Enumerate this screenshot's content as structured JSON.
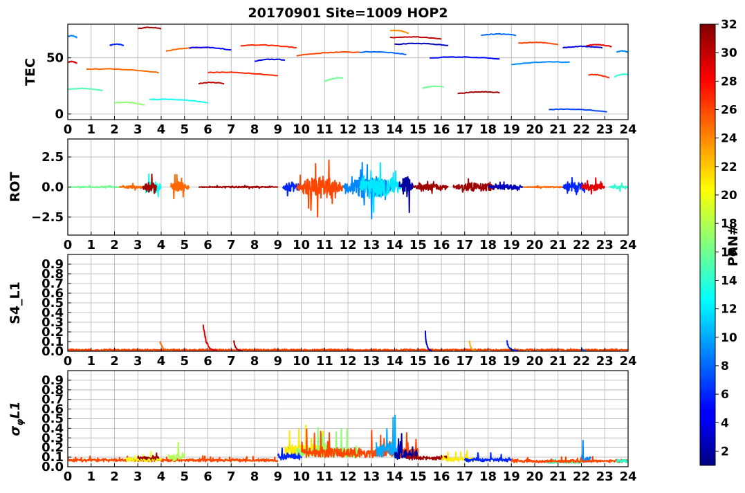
{
  "chart_data": {
    "title": "20170901 Site=1009 HOP2",
    "type": "line",
    "x_ticks": [
      "0",
      "1",
      "2",
      "3",
      "4",
      "5",
      "6",
      "7",
      "8",
      "9",
      "10",
      "11",
      "12",
      "13",
      "14",
      "15",
      "16",
      "17",
      "18",
      "19",
      "20",
      "21",
      "22",
      "23",
      "24"
    ],
    "xlim": [
      0,
      24
    ],
    "grid": true,
    "panels": [
      {
        "id": "tec",
        "ylabel": "TEC",
        "ylim": [
          -5,
          80
        ],
        "y_ticks": [
          {
            "v": 0,
            "t": "0"
          },
          {
            "v": 50,
            "t": "50"
          }
        ],
        "segments": [
          {
            "prn": 9,
            "x": [
              0,
              0.4
            ],
            "y": [
              69,
              68
            ]
          },
          {
            "prn": 29,
            "x": [
              0,
              0.4
            ],
            "y": [
              46,
              45
            ]
          },
          {
            "prn": 15,
            "x": [
              0,
              1.5
            ],
            "y": [
              22,
              21
            ]
          },
          {
            "prn": 25,
            "x": [
              0.8,
              3.9
            ],
            "y": [
              40,
              37
            ]
          },
          {
            "prn": 17,
            "x": [
              2,
              3.3
            ],
            "y": [
              10,
              8
            ]
          },
          {
            "prn": 13,
            "x": [
              3.5,
              6
            ],
            "y": [
              13,
              10
            ]
          },
          {
            "prn": 31,
            "x": [
              3,
              4
            ],
            "y": [
              76,
              76
            ]
          },
          {
            "prn": 6,
            "x": [
              1.8,
              2.4
            ],
            "y": [
              61,
              61
            ]
          },
          {
            "prn": 25,
            "x": [
              4.2,
              6
            ],
            "y": [
              56,
              59
            ]
          },
          {
            "prn": 5,
            "x": [
              5.2,
              7
            ],
            "y": [
              59,
              57
            ]
          },
          {
            "prn": 27,
            "x": [
              6,
              9
            ],
            "y": [
              37,
              34
            ]
          },
          {
            "prn": 30,
            "x": [
              5.6,
              6.7
            ],
            "y": [
              27,
              27
            ]
          },
          {
            "prn": 27,
            "x": [
              7.4,
              9.8
            ],
            "y": [
              61,
              59
            ]
          },
          {
            "prn": 4,
            "x": [
              8,
              9.3
            ],
            "y": [
              47,
              48
            ]
          },
          {
            "prn": 26,
            "x": [
              9.8,
              12.5
            ],
            "y": [
              52,
              55
            ]
          },
          {
            "prn": 8,
            "x": [
              12.5,
              14.5
            ],
            "y": [
              55,
              53
            ]
          },
          {
            "prn": 16,
            "x": [
              11,
              11.8
            ],
            "y": [
              29,
              32
            ]
          },
          {
            "prn": 24,
            "x": [
              13.8,
              14.6
            ],
            "y": [
              74,
              72
            ]
          },
          {
            "prn": 30,
            "x": [
              13.8,
              16
            ],
            "y": [
              68,
              67
            ]
          },
          {
            "prn": 3,
            "x": [
              14,
              16.3
            ],
            "y": [
              62,
              61
            ]
          },
          {
            "prn": 16,
            "x": [
              15.2,
              16.1
            ],
            "y": [
              23,
              24
            ]
          },
          {
            "prn": 5,
            "x": [
              15.5,
              18.5
            ],
            "y": [
              50,
              49
            ]
          },
          {
            "prn": 31,
            "x": [
              16.7,
              18.5
            ],
            "y": [
              18,
              19
            ]
          },
          {
            "prn": 8,
            "x": [
              17.7,
              19.2
            ],
            "y": [
              70,
              70
            ]
          },
          {
            "prn": 9,
            "x": [
              19,
              21.5
            ],
            "y": [
              44,
              46
            ]
          },
          {
            "prn": 26,
            "x": [
              19.3,
              21
            ],
            "y": [
              63,
              62
            ]
          },
          {
            "prn": 7,
            "x": [
              20.6,
              23.1
            ],
            "y": [
              4,
              2
            ]
          },
          {
            "prn": 4,
            "x": [
              21.2,
              22.9
            ],
            "y": [
              59,
              59
            ]
          },
          {
            "prn": 29,
            "x": [
              22.2,
              23.3
            ],
            "y": [
              61,
              60
            ]
          },
          {
            "prn": 27,
            "x": [
              22.3,
              23.2
            ],
            "y": [
              35,
              32
            ]
          },
          {
            "prn": 14,
            "x": [
              23.4,
              24
            ],
            "y": [
              33,
              35
            ]
          },
          {
            "prn": 9,
            "x": [
              23.5,
              24
            ],
            "y": [
              55,
              55
            ]
          }
        ]
      },
      {
        "id": "rot",
        "ylabel": "ROT",
        "ylim": [
          -4,
          4
        ],
        "y_ticks": [
          {
            "v": 2.5,
            "t": "2.5"
          },
          {
            "v": 0,
            "t": "0.0"
          },
          {
            "v": -2.5,
            "t": "−2.5"
          }
        ],
        "segments": [
          {
            "prn": 16,
            "x": [
              0,
              2.5
            ],
            "amp": 0.15
          },
          {
            "prn": 25,
            "x": [
              2.2,
              3.4
            ],
            "amp": 0.3
          },
          {
            "prn": 13,
            "x": [
              3.3,
              4
            ],
            "amp": 1.6
          },
          {
            "prn": 31,
            "x": [
              3.2,
              3.8
            ],
            "amp": 1.2
          },
          {
            "prn": 25,
            "x": [
              4.4,
              5.2
            ],
            "amp": 1.4
          },
          {
            "prn": 31,
            "x": [
              5.6,
              9
            ],
            "amp": 0.15
          },
          {
            "prn": 6,
            "x": [
              9.2,
              10
            ],
            "amp": 1.2
          },
          {
            "prn": 26,
            "x": [
              9.8,
              11.8
            ],
            "amp": 2.6
          },
          {
            "prn": 9,
            "x": [
              11.8,
              13.9
            ],
            "amp": 2.8
          },
          {
            "prn": 12,
            "x": [
              12.5,
              14.3
            ],
            "amp": 2.4
          },
          {
            "prn": 2,
            "x": [
              14.2,
              14.8
            ],
            "amp": 2.5
          },
          {
            "prn": 31,
            "x": [
              14.8,
              16.3
            ],
            "amp": 0.8
          },
          {
            "prn": 31,
            "x": [
              16.5,
              18.6
            ],
            "amp": 1.0
          },
          {
            "prn": 3,
            "x": [
              18,
              19.5
            ],
            "amp": 0.6
          },
          {
            "prn": 25,
            "x": [
              19.5,
              21.3
            ],
            "amp": 0.15
          },
          {
            "prn": 6,
            "x": [
              21.2,
              22.3
            ],
            "amp": 1.2
          },
          {
            "prn": 29,
            "x": [
              22,
              23
            ],
            "amp": 0.9
          },
          {
            "prn": 14,
            "x": [
              23.2,
              24
            ],
            "amp": 0.4
          }
        ]
      },
      {
        "id": "s4",
        "ylabel": "S4_L1",
        "ylim": [
          0,
          1
        ],
        "y_ticks": [
          {
            "v": 0,
            "t": "0.0"
          },
          {
            "v": 0.1,
            "t": "0.1"
          },
          {
            "v": 0.2,
            "t": "0.2"
          },
          {
            "v": 0.3,
            "t": "0.3"
          },
          {
            "v": 0.4,
            "t": "0.4"
          },
          {
            "v": 0.5,
            "t": "0.5"
          },
          {
            "v": 0.6,
            "t": "0.6"
          },
          {
            "v": 0.7,
            "t": "0.7"
          },
          {
            "v": 0.8,
            "t": "0.8"
          },
          {
            "v": 0.9,
            "t": "0.9"
          }
        ],
        "segments": [
          {
            "prn": 26,
            "x": [
              0,
              24
            ],
            "base": 0.01,
            "amp": 0.01
          },
          {
            "prn": 25,
            "x": [
              3.95,
              4.4
            ],
            "peak": 0.13
          },
          {
            "prn": 29,
            "x": [
              5.8,
              6.4
            ],
            "peak": 0.36
          },
          {
            "prn": 31,
            "x": [
              7.1,
              7.5
            ],
            "peak": 0.13
          },
          {
            "prn": 3,
            "x": [
              15.3,
              15.6
            ],
            "peak": 0.27
          },
          {
            "prn": 23,
            "x": [
              17.2,
              17.5
            ],
            "peak": 0.13
          },
          {
            "prn": 6,
            "x": [
              18.8,
              19.3
            ],
            "peak": 0.12
          },
          {
            "prn": 8,
            "x": [
              22,
              22.2
            ],
            "peak": 0.04
          }
        ]
      },
      {
        "id": "sigma",
        "ylabel": "σφL1",
        "ylim": [
          0,
          1
        ],
        "y_ticks": [
          {
            "v": 0,
            "t": "0.0"
          },
          {
            "v": 0.1,
            "t": "0.1"
          },
          {
            "v": 0.2,
            "t": "0.2"
          },
          {
            "v": 0.3,
            "t": "0.3"
          },
          {
            "v": 0.4,
            "t": "0.4"
          },
          {
            "v": 0.5,
            "t": "0.5"
          },
          {
            "v": 0.6,
            "t": "0.6"
          },
          {
            "v": 0.7,
            "t": "0.7"
          },
          {
            "v": 0.8,
            "t": "0.8"
          },
          {
            "v": 0.9,
            "t": "0.9"
          }
        ],
        "segments": [
          {
            "prn": 26,
            "x": [
              0,
              9
            ],
            "base": 0.06,
            "amp": 0.05
          },
          {
            "prn": 20,
            "x": [
              2.5,
              4
            ],
            "base": 0.06,
            "amp": 0.1
          },
          {
            "prn": 18,
            "x": [
              4.3,
              5
            ],
            "base": 0.07,
            "amp": 0.2
          },
          {
            "prn": 31,
            "x": [
              3,
              3.9
            ],
            "base": 0.08,
            "amp": 0.08
          },
          {
            "prn": 6,
            "x": [
              9,
              10
            ],
            "base": 0.08,
            "amp": 0.2
          },
          {
            "prn": 21,
            "x": [
              9.3,
              11.2
            ],
            "base": 0.12,
            "amp": 0.35
          },
          {
            "prn": 17,
            "x": [
              9.8,
              12.5
            ],
            "base": 0.1,
            "amp": 0.3
          },
          {
            "prn": 26,
            "x": [
              10,
              15
            ],
            "base": 0.1,
            "amp": 0.3
          },
          {
            "prn": 10,
            "x": [
              13.2,
              14.3
            ],
            "base": 0.1,
            "amp": 0.5
          },
          {
            "prn": 2,
            "x": [
              14,
              15
            ],
            "base": 0.08,
            "amp": 0.3
          },
          {
            "prn": 31,
            "x": [
              14.5,
              16.3
            ],
            "base": 0.08,
            "amp": 0.08
          },
          {
            "prn": 21,
            "x": [
              16,
              17.5
            ],
            "base": 0.06,
            "amp": 0.1
          },
          {
            "prn": 6,
            "x": [
              17,
              19
            ],
            "base": 0.06,
            "amp": 0.08
          },
          {
            "prn": 15,
            "x": [
              20.5,
              22
            ],
            "base": 0.04,
            "amp": 0.04
          },
          {
            "prn": 9,
            "x": [
              22,
              22.4
            ],
            "base": 0.05,
            "amp": 0.22
          },
          {
            "prn": 26,
            "x": [
              19,
              24
            ],
            "base": 0.05,
            "amp": 0.05
          },
          {
            "prn": 14,
            "x": [
              23.5,
              24
            ],
            "base": 0.05,
            "amp": 0.06
          }
        ]
      }
    ],
    "colorbar": {
      "label": "PRN#",
      "range": [
        1,
        32
      ],
      "ticks": [
        {
          "v": 2,
          "t": "2"
        },
        {
          "v": 4,
          "t": "4"
        },
        {
          "v": 6,
          "t": "6"
        },
        {
          "v": 8,
          "t": "8"
        },
        {
          "v": 10,
          "t": "10"
        },
        {
          "v": 12,
          "t": "12"
        },
        {
          "v": 14,
          "t": "14"
        },
        {
          "v": 16,
          "t": "16"
        },
        {
          "v": 18,
          "t": "18"
        },
        {
          "v": 20,
          "t": "20"
        },
        {
          "v": 22,
          "t": "22"
        },
        {
          "v": 24,
          "t": "24"
        },
        {
          "v": 26,
          "t": "26"
        },
        {
          "v": 28,
          "t": "28"
        },
        {
          "v": 30,
          "t": "30"
        },
        {
          "v": 32,
          "t": "32"
        }
      ],
      "colormap": "jet"
    }
  }
}
